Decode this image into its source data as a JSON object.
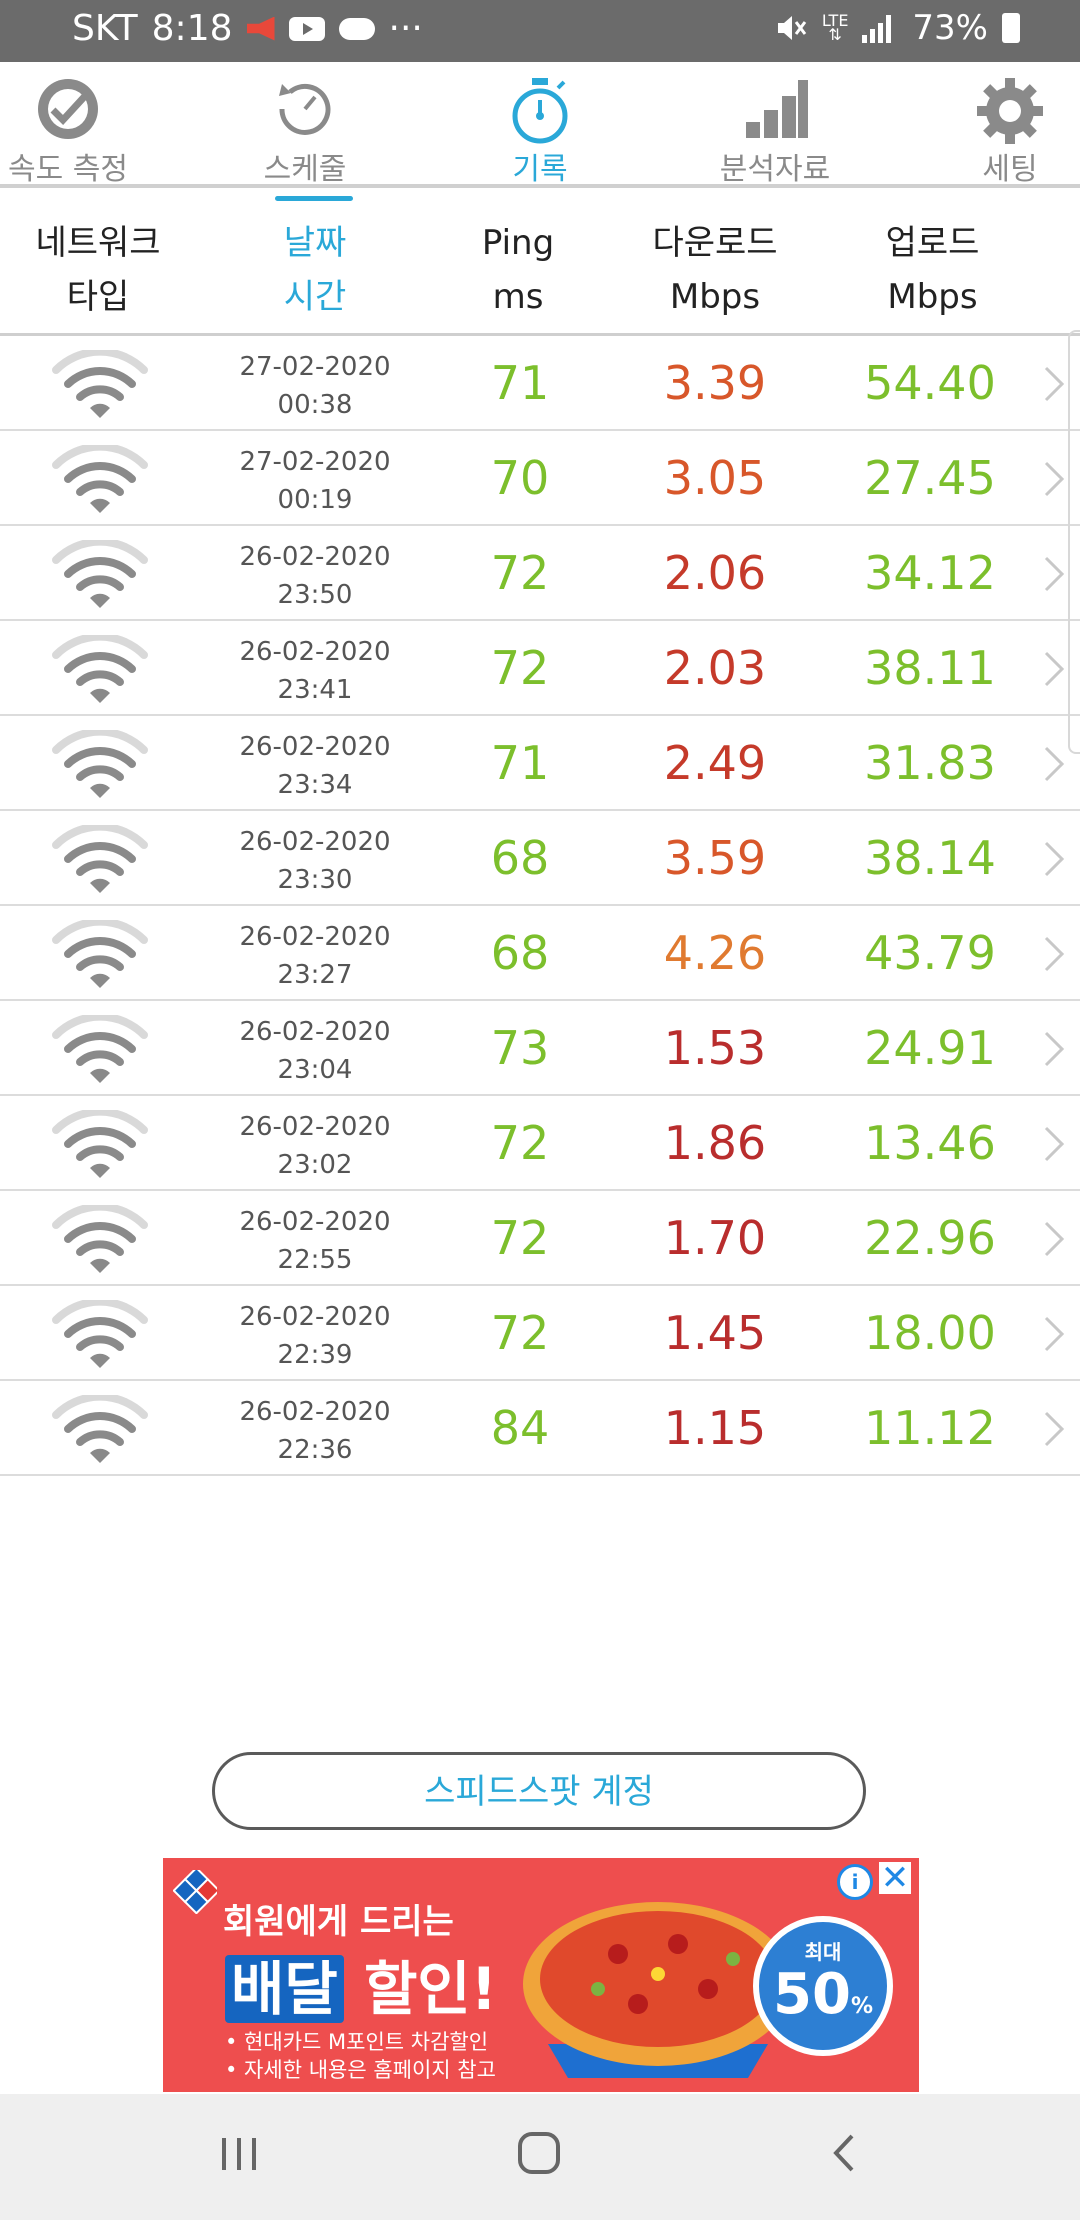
{
  "status_bar": {
    "carrier": "SKT",
    "time": "8:18",
    "more": "···",
    "network": "LTE",
    "battery": "73%"
  },
  "nav": {
    "tabs": [
      {
        "label": "속도 측정",
        "icon": "speedometer-icon"
      },
      {
        "label": "스케줄",
        "icon": "schedule-icon"
      },
      {
        "label": "기록",
        "icon": "stopwatch-icon",
        "active": true
      },
      {
        "label": "분석자료",
        "icon": "bar-chart-icon"
      },
      {
        "label": "세팅",
        "icon": "gear-icon"
      }
    ]
  },
  "table": {
    "headers": {
      "network_type": [
        "네트워크",
        "타입"
      ],
      "datetime": [
        "날짜",
        "시간"
      ],
      "ping": [
        "Ping",
        "ms"
      ],
      "download": [
        "다운로드",
        "Mbps"
      ],
      "upload": [
        "업로드",
        "Mbps"
      ]
    },
    "rows": [
      {
        "date": "27-02-2020",
        "time": "00:38",
        "ping": "71",
        "download": "3.39",
        "download_color": "#d8572a",
        "upload": "54.40"
      },
      {
        "date": "27-02-2020",
        "time": "00:19",
        "ping": "70",
        "download": "3.05",
        "download_color": "#d8572a",
        "upload": "27.45"
      },
      {
        "date": "26-02-2020",
        "time": "23:50",
        "ping": "72",
        "download": "2.06",
        "download_color": "#c53a2a",
        "upload": "34.12"
      },
      {
        "date": "26-02-2020",
        "time": "23:41",
        "ping": "72",
        "download": "2.03",
        "download_color": "#c53a2a",
        "upload": "38.11"
      },
      {
        "date": "26-02-2020",
        "time": "23:34",
        "ping": "71",
        "download": "2.49",
        "download_color": "#c53a2a",
        "upload": "31.83"
      },
      {
        "date": "26-02-2020",
        "time": "23:30",
        "ping": "68",
        "download": "3.59",
        "download_color": "#d8572a",
        "upload": "38.14"
      },
      {
        "date": "26-02-2020",
        "time": "23:27",
        "ping": "68",
        "download": "4.26",
        "download_color": "#e07a30",
        "upload": "43.79"
      },
      {
        "date": "26-02-2020",
        "time": "23:04",
        "ping": "73",
        "download": "1.53",
        "download_color": "#b92d2d",
        "upload": "24.91"
      },
      {
        "date": "26-02-2020",
        "time": "23:02",
        "ping": "72",
        "download": "1.86",
        "download_color": "#b92d2d",
        "upload": "13.46"
      },
      {
        "date": "26-02-2020",
        "time": "22:55",
        "ping": "72",
        "download": "1.70",
        "download_color": "#b92d2d",
        "upload": "22.96"
      },
      {
        "date": "26-02-2020",
        "time": "22:39",
        "ping": "72",
        "download": "1.45",
        "download_color": "#b92d2d",
        "upload": "18.00"
      },
      {
        "date": "26-02-2020",
        "time": "22:36",
        "ping": "84",
        "download": "1.15",
        "download_color": "#b92d2d",
        "upload": "11.12"
      }
    ]
  },
  "account_button": "스피드스팟 계정",
  "ad": {
    "line1": "회원에게 드리는",
    "line2_highlight": "배달",
    "line2_rest": "할인!",
    "bullet1": "• 현대카드 M포인트 차감할인",
    "bullet2": "• 자세한 내용은 홈페이지 참고",
    "badge_small": "최대",
    "badge_big": "50",
    "badge_unit": "%",
    "info": "i",
    "close": "✕"
  },
  "colors": {
    "accent": "#2aa8d8",
    "green": "#7cbf2c"
  }
}
